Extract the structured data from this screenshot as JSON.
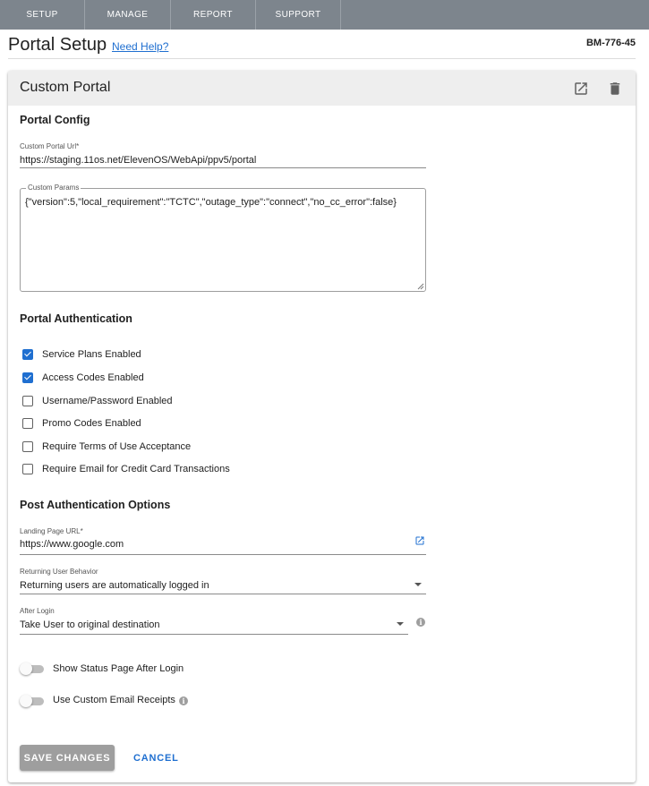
{
  "nav": {
    "tabs": [
      {
        "label": "SETUP"
      },
      {
        "label": "MANAGE"
      },
      {
        "label": "REPORT"
      },
      {
        "label": "SUPPORT"
      }
    ]
  },
  "header": {
    "title": "Portal Setup",
    "help_link": "Need Help?",
    "site_id": "BM-776-45"
  },
  "card": {
    "title": "Custom Portal",
    "icons": {
      "open": "open-in-new-icon",
      "delete": "trash-icon"
    }
  },
  "portal_config": {
    "section_title": "Portal Config",
    "url_label": "Custom Portal Url*",
    "url_value": "https://staging.11os.net/ElevenOS/WebApi/ppv5/portal",
    "params_label": "Custom Params",
    "params_value": "{\"version\":5,\"local_requirement\":\"TCTC\",\"outage_type\":\"connect\",\"no_cc_error\":false}"
  },
  "portal_auth": {
    "section_title": "Portal Authentication",
    "options": [
      {
        "label": "Service Plans Enabled",
        "checked": true
      },
      {
        "label": "Access Codes Enabled",
        "checked": true
      },
      {
        "label": "Username/Password Enabled",
        "checked": false
      },
      {
        "label": "Promo Codes Enabled",
        "checked": false
      },
      {
        "label": "Require Terms of Use Acceptance",
        "checked": false
      },
      {
        "label": "Require Email for Credit Card Transactions",
        "checked": false
      }
    ]
  },
  "post_auth": {
    "section_title": "Post Authentication Options",
    "landing_label": "Landing Page URL*",
    "landing_value": "https://www.google.com",
    "returning_label": "Returning User Behavior",
    "returning_value": "Returning users are automatically logged in",
    "after_login_label": "After Login",
    "after_login_value": "Take User to original destination",
    "toggles": [
      {
        "label": "Show Status Page After Login",
        "on": false
      },
      {
        "label": "Use Custom Email Receipts",
        "on": false
      }
    ]
  },
  "actions": {
    "save_label": "SAVE CHANGES",
    "cancel_label": "CANCEL"
  },
  "colors": {
    "nav_bg": "#7d858d",
    "accent": "#1f6fd0",
    "card_header_bg": "#eeeeee",
    "disabled_button": "#9e9e9e"
  }
}
